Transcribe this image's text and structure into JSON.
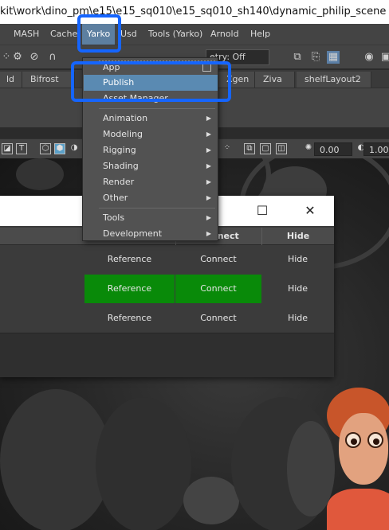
{
  "window_title": "kit\\work\\dino_pm\\e15\\e15_sq010\\e15_sq010_sh140\\dynamic_philip_scene",
  "menubar": {
    "items": [
      "MASH",
      "Cache",
      "Yarko",
      "Usd",
      "Tools (Yarko)",
      "Arnold",
      "Help"
    ],
    "active": "Yarko"
  },
  "statusline": {
    "symmetry_value": "etry: Off"
  },
  "shelf": {
    "tabs": [
      "ld",
      "Bifrost",
      "Xgen",
      "Ziva",
      "shelfLayout2"
    ]
  },
  "panel_toolbar": {
    "value_a": "0.00",
    "value_b": "1.00"
  },
  "dropdown": {
    "items": [
      {
        "label": "App",
        "checkbox": true
      },
      {
        "label": "Publish",
        "highlighted": true
      },
      {
        "label": "Asset Manager"
      },
      {
        "label": "Animation",
        "submenu": true
      },
      {
        "label": "Modeling",
        "submenu": true
      },
      {
        "label": "Rigging",
        "submenu": true
      },
      {
        "label": "Shading",
        "submenu": true
      },
      {
        "label": "Render",
        "submenu": true
      },
      {
        "label": "Other",
        "submenu": true
      },
      {
        "label": "Tools",
        "submenu": true
      },
      {
        "label": "Development",
        "submenu": true
      }
    ]
  },
  "tool_window": {
    "header": {
      "connect": "Connect",
      "hide": "Hide"
    },
    "rows": [
      {
        "reference": "Reference",
        "connect": "Connect",
        "hide": "Hide",
        "highlighted": false
      },
      {
        "reference": "Reference",
        "connect": "Connect",
        "hide": "Hide",
        "highlighted": true
      },
      {
        "reference": "Reference",
        "connect": "Connect",
        "hide": "Hide",
        "highlighted": false
      }
    ],
    "colors": {
      "highlight": "#098a09"
    }
  },
  "annotations": {
    "highlight_color": "#1565ff"
  }
}
